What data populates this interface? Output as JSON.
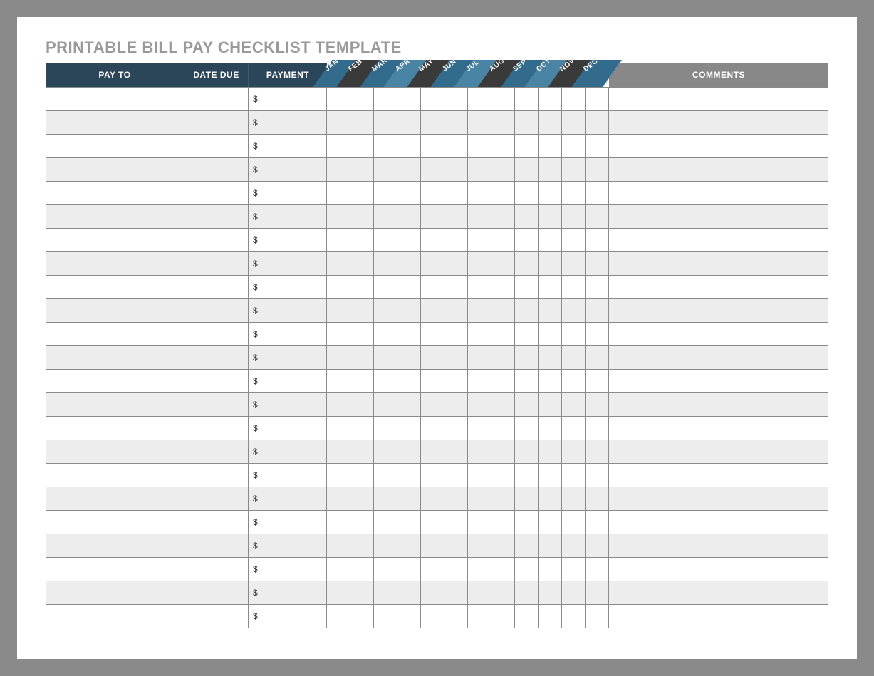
{
  "title": "PRINTABLE BILL PAY CHECKLIST TEMPLATE",
  "header": {
    "payto": "PAY TO",
    "datedue": "DATE DUE",
    "payment": "PAYMENT",
    "comments": "COMMENTS"
  },
  "months": [
    {
      "label": "JAN",
      "tone": "blue"
    },
    {
      "label": "FEB",
      "tone": "dark"
    },
    {
      "label": "MAR",
      "tone": "blue"
    },
    {
      "label": "APR",
      "tone": "lblue"
    },
    {
      "label": "MAY",
      "tone": "dark"
    },
    {
      "label": "JUN",
      "tone": "blue"
    },
    {
      "label": "JUL",
      "tone": "lblue"
    },
    {
      "label": "AUG",
      "tone": "dark"
    },
    {
      "label": "SEP",
      "tone": "blue"
    },
    {
      "label": "OCT",
      "tone": "lblue"
    },
    {
      "label": "NOV",
      "tone": "dark"
    },
    {
      "label": "DEC",
      "tone": "blue"
    }
  ],
  "currency_symbol": "$",
  "row_count": 23,
  "rows": []
}
